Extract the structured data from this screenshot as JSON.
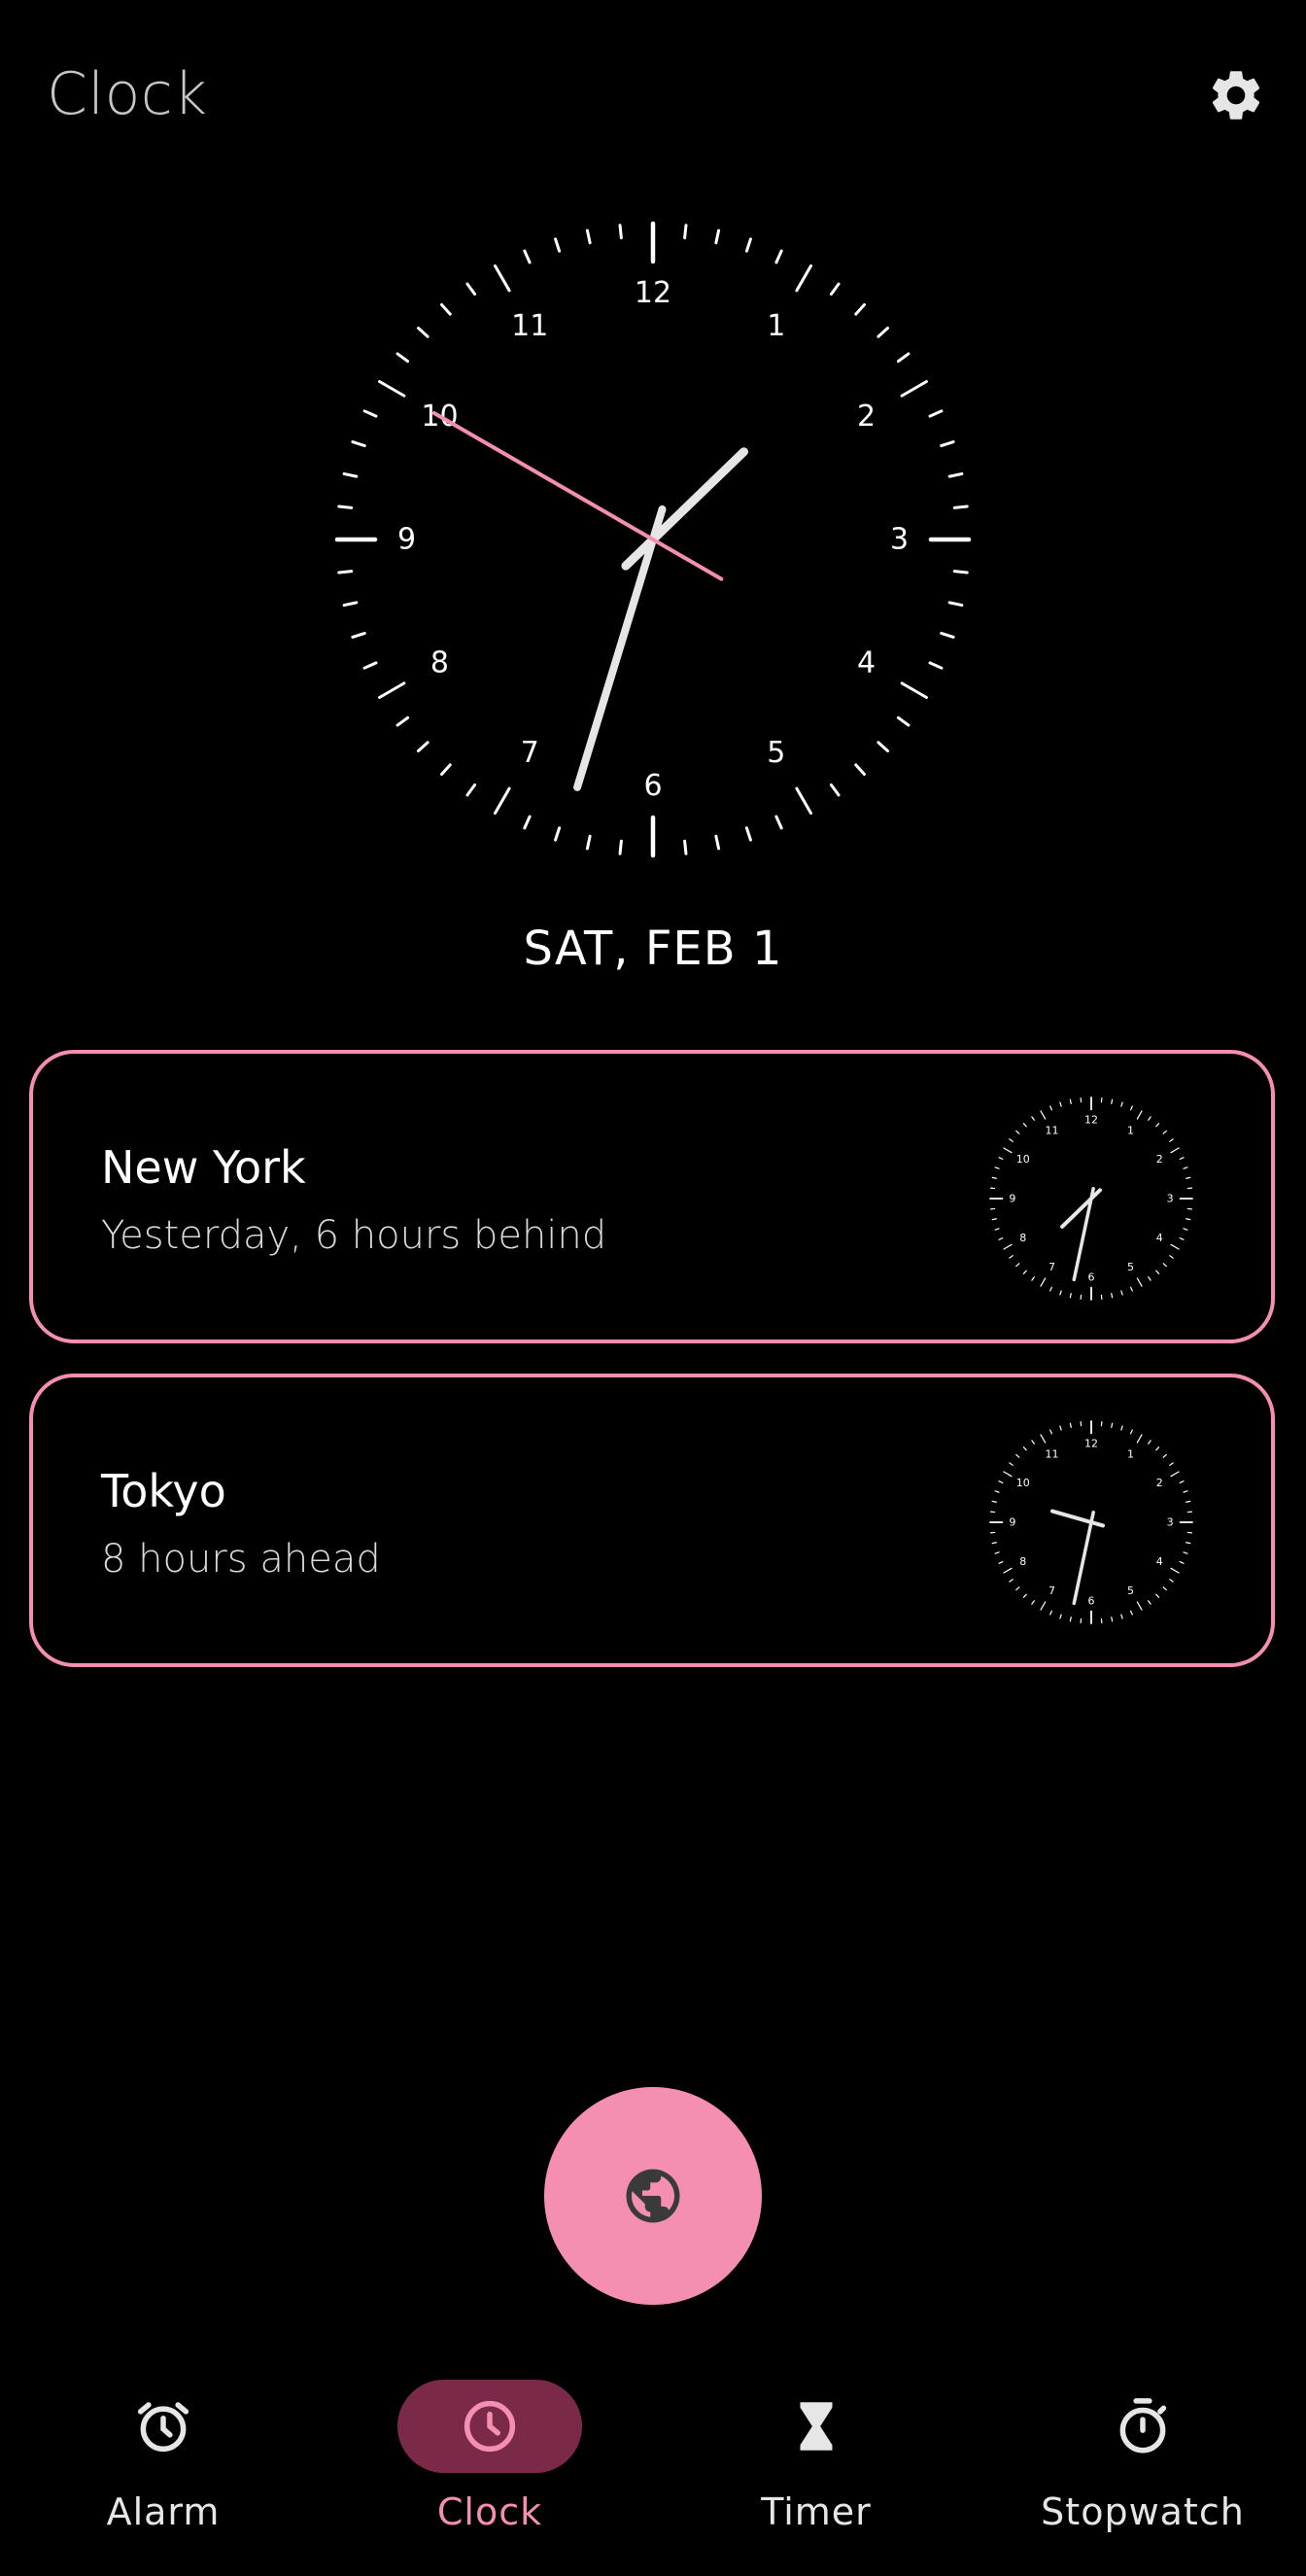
{
  "app": {
    "title": "Clock"
  },
  "header": {
    "settings_icon": "gear-icon"
  },
  "main_clock": {
    "date": "SAT, FEB 1",
    "time": {
      "hour": 1,
      "minute": 32,
      "second": 50
    },
    "second_hand_color": "#f48fb1"
  },
  "cities": [
    {
      "name": "New York",
      "offset": "Yesterday, 6 hours behind",
      "time": {
        "hour": 7,
        "minute": 32
      }
    },
    {
      "name": "Tokyo",
      "offset": "8 hours ahead",
      "time": {
        "hour": 9,
        "minute": 32
      }
    }
  ],
  "fab": {
    "icon": "globe-icon"
  },
  "nav": {
    "items": [
      {
        "label": "Alarm",
        "icon": "alarm-icon",
        "active": false
      },
      {
        "label": "Clock",
        "icon": "clock-icon",
        "active": true
      },
      {
        "label": "Timer",
        "icon": "hourglass-icon",
        "active": false
      },
      {
        "label": "Stopwatch",
        "icon": "stopwatch-icon",
        "active": false
      }
    ]
  },
  "colors": {
    "accent": "#f48fb1",
    "accent_dark": "#7a2a48",
    "background": "#000000"
  }
}
